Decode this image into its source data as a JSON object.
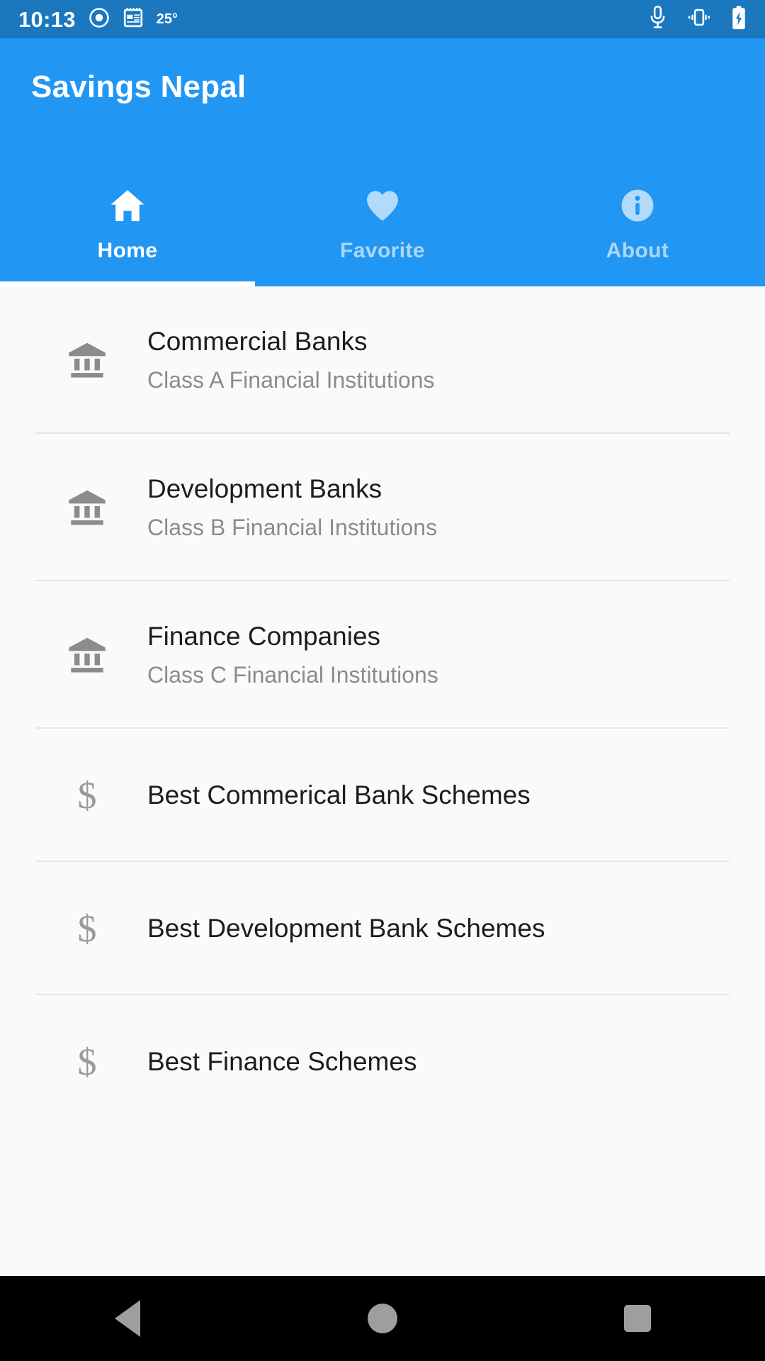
{
  "status_bar": {
    "time": "10:13",
    "temperature": "25°",
    "left_icons": [
      "record-dot-icon",
      "calendar-note-icon"
    ],
    "right_icons": [
      "microphone-icon",
      "vibrate-icon",
      "battery-charging-icon"
    ],
    "background_color": "#1b78bf"
  },
  "app_bar": {
    "title": "Savings Nepal",
    "background_color": "#2196f3"
  },
  "tabs": [
    {
      "label": "Home",
      "icon": "home-icon",
      "active": true
    },
    {
      "label": "Favorite",
      "icon": "heart-icon",
      "active": false
    },
    {
      "label": "About",
      "icon": "info-circle-icon",
      "active": false
    }
  ],
  "list": {
    "items": [
      {
        "title": "Commercial Banks",
        "subtitle": "Class A Financial Institutions",
        "icon": "bank-icon"
      },
      {
        "title": "Development Banks",
        "subtitle": "Class B Financial Institutions",
        "icon": "bank-icon"
      },
      {
        "title": "Finance Companies",
        "subtitle": "Class C Financial Institutions",
        "icon": "bank-icon"
      },
      {
        "title": "Best Commerical Bank Schemes",
        "subtitle": "",
        "icon": "dollar-icon"
      },
      {
        "title": "Best Development Bank Schemes",
        "subtitle": "",
        "icon": "dollar-icon"
      },
      {
        "title": "Best Finance Schemes",
        "subtitle": "",
        "icon": "dollar-icon"
      }
    ],
    "dollar_glyph": "$",
    "background_color": "#fafafa"
  },
  "nav_bar": {
    "buttons": [
      "back-button",
      "home-button",
      "recents-button"
    ],
    "background_color": "#000000"
  }
}
